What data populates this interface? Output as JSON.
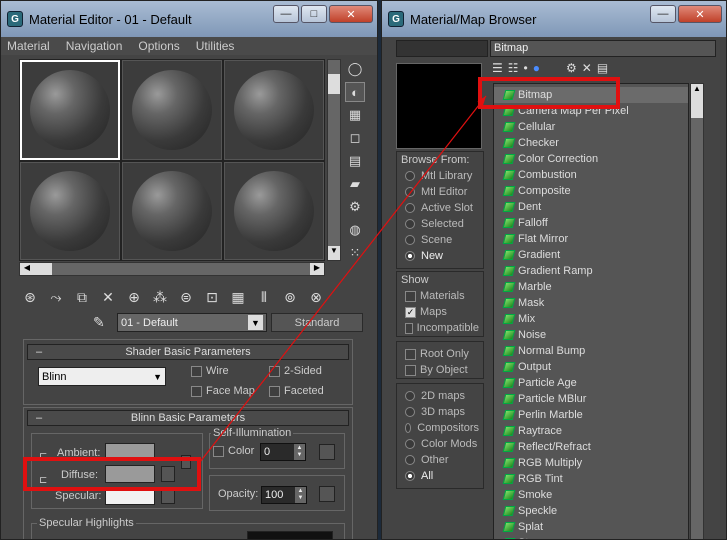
{
  "material_editor": {
    "title": "Material Editor - 01 - Default",
    "menu": [
      "Material",
      "Navigation",
      "Options",
      "Utilities"
    ],
    "material_name": "01 - Default",
    "material_type": "Standard",
    "shader_rollout": {
      "title": "Shader Basic Parameters",
      "shader": "Blinn",
      "wire": "Wire",
      "two_sided": "2-Sided",
      "face_map": "Face Map",
      "faceted": "Faceted"
    },
    "blinn_rollout": {
      "title": "Blinn Basic Parameters",
      "self_illum_title": "Self-Illumination",
      "color_label": "Color",
      "color_value": "0",
      "ambient_label": "Ambient:",
      "diffuse_label": "Diffuse:",
      "specular_label": "Specular:",
      "opacity_label": "Opacity:",
      "opacity_value": "100",
      "specular_highlights": "Specular Highlights"
    },
    "colors": {
      "ambient": "#9a9a9a",
      "diffuse": "#9a9a9a",
      "specular": "#f2f2f2"
    }
  },
  "browser": {
    "title": "Material/Map Browser",
    "search_value": "",
    "name_value": "Bitmap",
    "browse_from": {
      "title": "Browse From:",
      "options": [
        "Mtl Library",
        "Mtl Editor",
        "Active Slot",
        "Selected",
        "Scene",
        "New"
      ],
      "selected": "New"
    },
    "show": {
      "title": "Show",
      "materials": "Materials",
      "maps": "Maps",
      "incompatible": "Incompatible"
    },
    "root_only": "Root Only",
    "by_object": "By Object",
    "categories": {
      "options": [
        "2D maps",
        "3D maps",
        "Compositors",
        "Color Mods",
        "Other",
        "All"
      ],
      "selected": "All"
    },
    "maps": [
      "Bitmap",
      "Camera Map Per Pixel",
      "Cellular",
      "Checker",
      "Color Correction",
      "Combustion",
      "Composite",
      "Dent",
      "Falloff",
      "Flat Mirror",
      "Gradient",
      "Gradient Ramp",
      "Marble",
      "Mask",
      "Mix",
      "Noise",
      "Normal Bump",
      "Output",
      "Particle Age",
      "Particle MBlur",
      "Perlin Marble",
      "Raytrace",
      "Reflect/Refract",
      "RGB Multiply",
      "RGB Tint",
      "Smoke",
      "Speckle",
      "Splat",
      "Stucco"
    ]
  },
  "accent": {
    "highlight": "#e01010"
  }
}
